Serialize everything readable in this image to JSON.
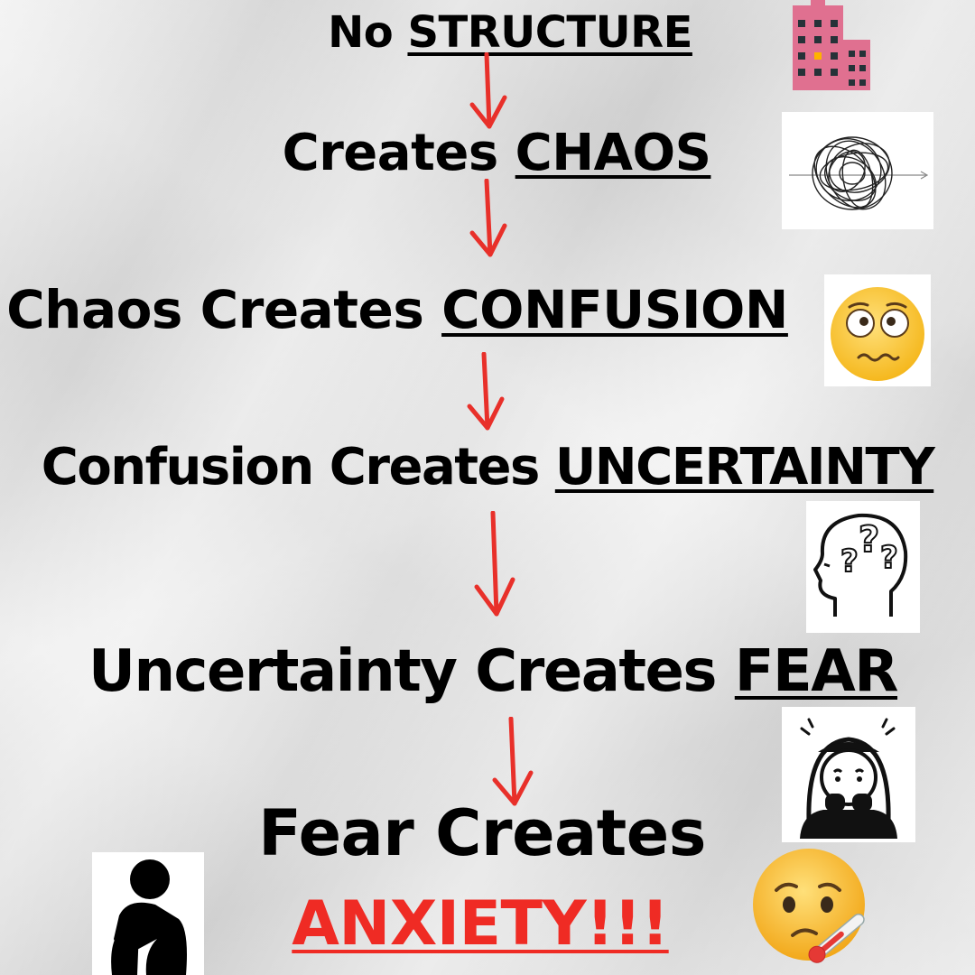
{
  "flow": [
    {
      "prefix": "No ",
      "emphasis": "STRUCTURE"
    },
    {
      "prefix": "Creates ",
      "emphasis": "CHAOS"
    },
    {
      "prefix": "Chaos Creates ",
      "emphasis": "CONFUSION"
    },
    {
      "prefix": "Confusion Creates ",
      "emphasis": "UNCERTAINTY"
    },
    {
      "prefix": "Uncertainty Creates ",
      "emphasis": "FEAR"
    },
    {
      "prefix": "Fear Creates",
      "emphasis": ""
    }
  ],
  "final_word": "ANXIETY!!!",
  "icons": {
    "structure": "building-icon",
    "chaos": "tangled-scribble-icon",
    "confusion": "confused-face-emoji",
    "uncertainty": "head-question-marks-icon",
    "fear": "frightened-person-icon",
    "anxiety_left": "sitting-sad-person-icon",
    "anxiety_right": "sick-face-thermometer-emoji"
  },
  "colors": {
    "text": "#000000",
    "arrow": "#e8302a",
    "anxiety": "#ef2b24",
    "building": "#e07090",
    "emoji": "#ffc93c"
  }
}
